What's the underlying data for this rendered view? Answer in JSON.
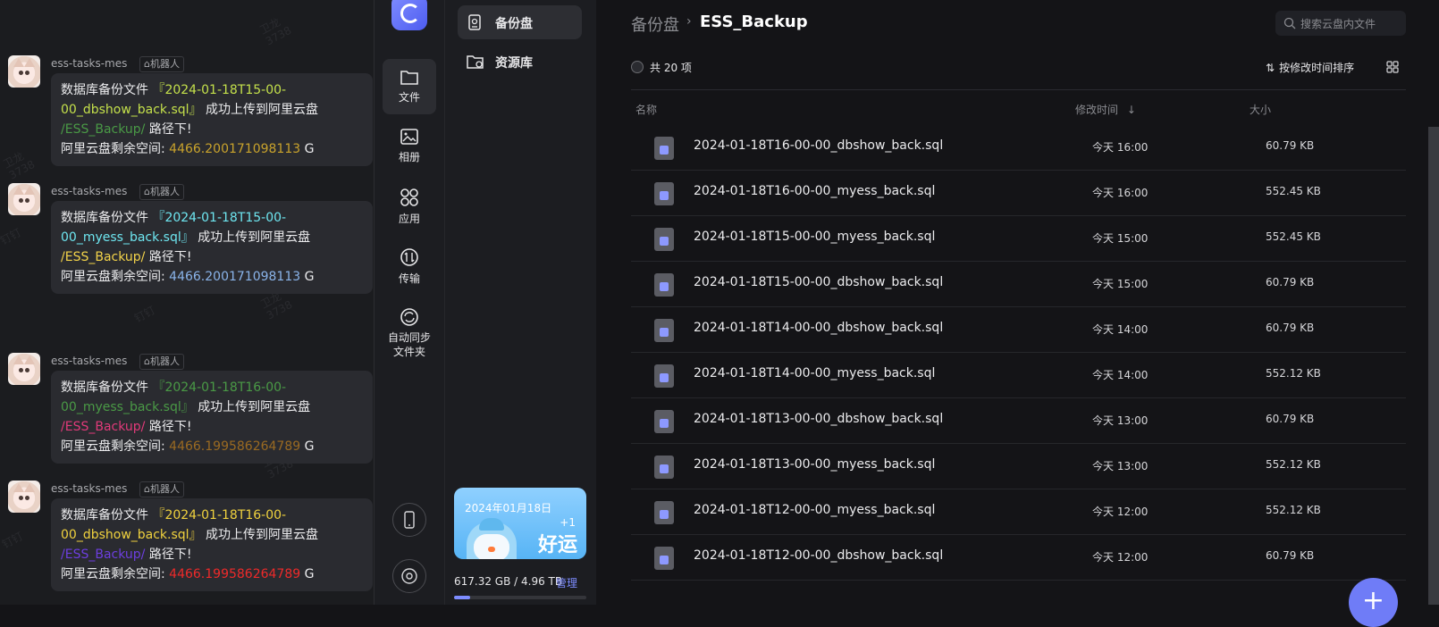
{
  "chat": {
    "watermarks": [
      "卫龙\n3738",
      "钉钉",
      "卫龙\n3738",
      "钉钉",
      "卫龙\n3738",
      "钉钉",
      "卫龙\n3738",
      "钉钉"
    ],
    "messages": [
      {
        "sender": "ess-tasks-mes",
        "badge": "机器人",
        "prefix": "数据库备份文件",
        "file": "『2024-01-18T15-00-00_dbshow_back.sql』",
        "file_color": "#c4e04b",
        "mid": "成功上传到阿里云盘",
        "path": "/ESS_Backup/",
        "path_color": "#4a9a46",
        "suffix": "路径下!",
        "space_label": "阿里云盘剩余空间:",
        "space_value": "4466.200171098113",
        "space_color": "#c9a32c",
        "unit": "G"
      },
      {
        "sender": "ess-tasks-mes",
        "badge": "机器人",
        "prefix": "数据库备份文件",
        "file": "『2024-01-18T15-00-00_myess_back.sql』",
        "file_color": "#6ee6f0",
        "mid": "成功上传到阿里云盘",
        "path": "/ESS_Backup/",
        "path_color": "#f4d44a",
        "suffix": "路径下!",
        "space_label": "阿里云盘剩余空间:",
        "space_value": "4466.200171098113",
        "space_color": "#8ab4ea",
        "unit": "G"
      },
      {
        "sender": "ess-tasks-mes",
        "badge": "机器人",
        "prefix": "数据库备份文件",
        "file": "『2024-01-18T16-00-00_myess_back.sql』",
        "file_color": "#4a9a46",
        "mid": "成功上传到阿里云盘",
        "path": "/ESS_Backup/",
        "path_color": "#e23a7a",
        "suffix": "路径下!",
        "space_label": "阿里云盘剩余空间:",
        "space_value": "4466.199586264789",
        "space_color": "#9a6a22",
        "unit": "G"
      },
      {
        "sender": "ess-tasks-mes",
        "badge": "机器人",
        "prefix": "数据库备份文件",
        "file": "『2024-01-18T16-00-00_dbshow_back.sql』",
        "file_color": "#f0d23e",
        "mid": "成功上传到阿里云盘",
        "path": "/ESS_Backup/",
        "path_color": "#6d3ee0",
        "suffix": "路径下!",
        "space_label": "阿里云盘剩余空间:",
        "space_value": "4466.199586264789",
        "space_color": "#ee2a2a",
        "unit": "G"
      }
    ]
  },
  "nav": {
    "items": [
      {
        "label": "文件",
        "icon": "folder-icon"
      },
      {
        "label": "相册",
        "icon": "photo-icon"
      },
      {
        "label": "应用",
        "icon": "apps-icon"
      },
      {
        "label": "传输",
        "icon": "transfer-icon"
      },
      {
        "label": "自动同步\n文件夹",
        "icon": "sync-icon"
      }
    ]
  },
  "sidebar": {
    "items": [
      {
        "label": "备份盘",
        "icon": "backup-drive-icon"
      },
      {
        "label": "资源库",
        "icon": "resource-folder-icon"
      }
    ],
    "banner": {
      "date": "2024年01月18日",
      "plus": "+1",
      "text": "好运"
    },
    "quota": {
      "text": "617.32 GB / 4.96 TB",
      "manage": "管理",
      "used_fraction": 0.12
    }
  },
  "main": {
    "breadcrumb": {
      "root": "备份盘",
      "separator": "›",
      "current": "ESS_Backup"
    },
    "search_placeholder": "搜索云盘内文件",
    "count": "共 20 项",
    "sort": "按修改时间排序",
    "columns": {
      "name": "名称",
      "modified": "修改时间",
      "modified_arrow": "↓",
      "size": "大小"
    },
    "files": [
      {
        "name": "2024-01-18T16-00-00_dbshow_back.sql",
        "time": "今天 16:00",
        "size": "60.79 KB"
      },
      {
        "name": "2024-01-18T16-00-00_myess_back.sql",
        "time": "今天 16:00",
        "size": "552.45 KB"
      },
      {
        "name": "2024-01-18T15-00-00_myess_back.sql",
        "time": "今天 15:00",
        "size": "552.45 KB"
      },
      {
        "name": "2024-01-18T15-00-00_dbshow_back.sql",
        "time": "今天 15:00",
        "size": "60.79 KB"
      },
      {
        "name": "2024-01-18T14-00-00_dbshow_back.sql",
        "time": "今天 14:00",
        "size": "60.79 KB"
      },
      {
        "name": "2024-01-18T14-00-00_myess_back.sql",
        "time": "今天 14:00",
        "size": "552.12 KB"
      },
      {
        "name": "2024-01-18T13-00-00_dbshow_back.sql",
        "time": "今天 13:00",
        "size": "60.79 KB"
      },
      {
        "name": "2024-01-18T13-00-00_myess_back.sql",
        "time": "今天 13:00",
        "size": "552.12 KB"
      },
      {
        "name": "2024-01-18T12-00-00_myess_back.sql",
        "time": "今天 12:00",
        "size": "552.12 KB"
      },
      {
        "name": "2024-01-18T12-00-00_dbshow_back.sql",
        "time": "今天 12:00",
        "size": "60.79 KB"
      }
    ],
    "fab": "+"
  }
}
